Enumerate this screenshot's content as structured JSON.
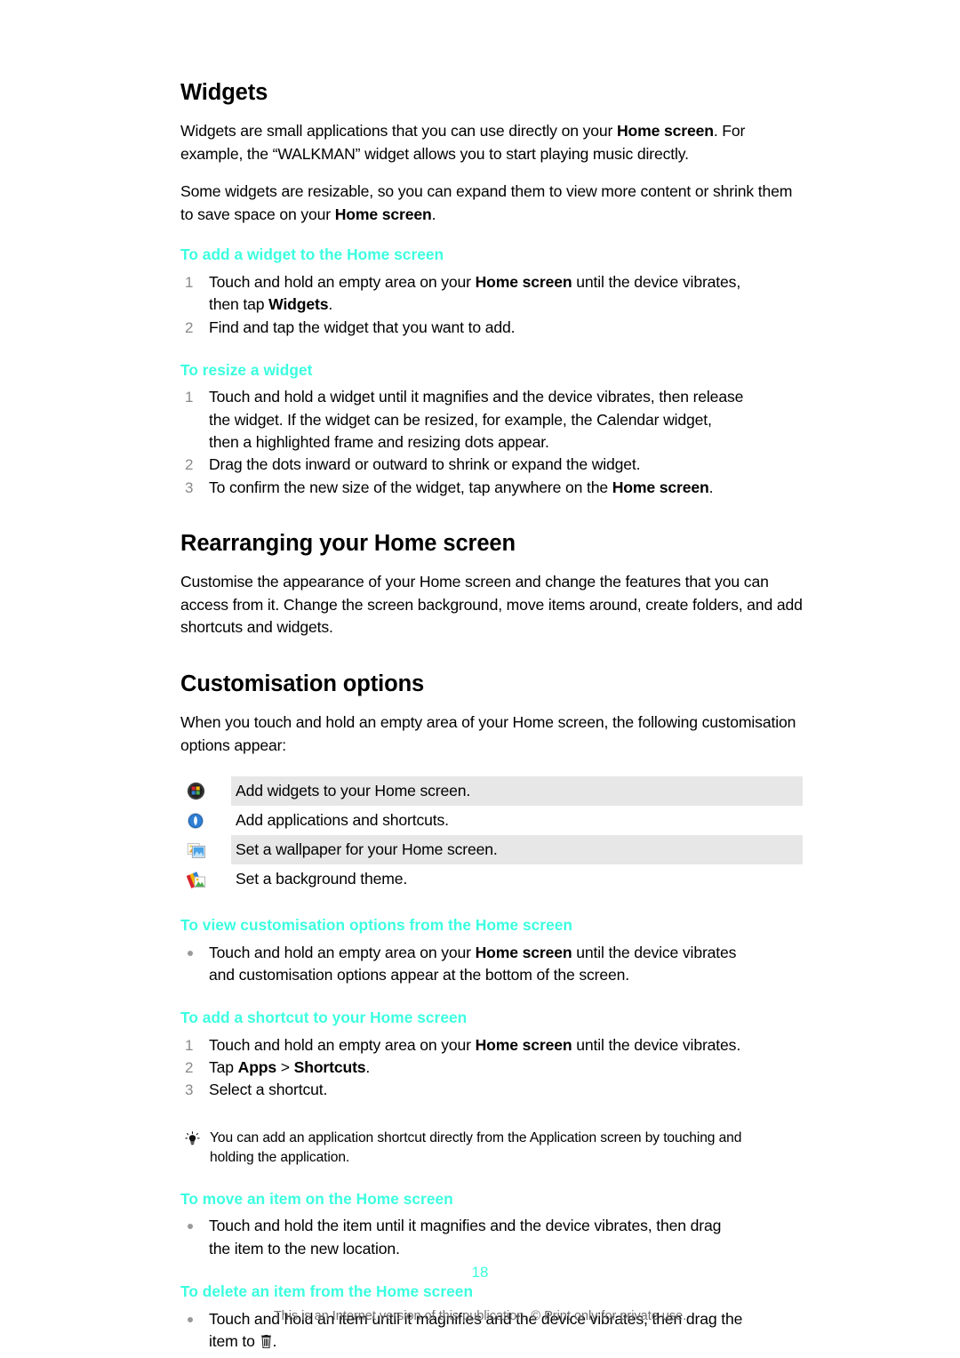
{
  "document": {
    "page_number": "18",
    "footer_note": "This is an Internet version of this publication. © Print only for private use.",
    "accent_color": "#3BFFE0",
    "row_shade_color": "#E7E7E7"
  },
  "sections": [
    {
      "title": "Widgets",
      "paragraphs": [
        "Widgets are small applications that you can use directly on your Home screen. For example, the “WALKMAN” widget allows you to start playing music directly.",
        "Some widgets are resizable, so you can expand them to view more content or shrink them to save space on your Home screen."
      ]
    },
    {
      "title": "Rearranging your Home screen",
      "paragraphs": [
        "Customise the appearance of your Home screen and change the features that you can access from it. Change the screen background, move items around, create folders, and add shortcuts and widgets."
      ]
    },
    {
      "title": "Customisation options",
      "paragraphs": [
        "When you touch and hold an empty area of your Home screen, the following customisation options appear:"
      ]
    }
  ],
  "procedures": {
    "add_widget": {
      "heading": "To add a widget to the Home screen",
      "steps": [
        {
          "marker": "1",
          "text": "Touch and hold an empty area on your Home screen until the device vibrates, then tap Widgets."
        },
        {
          "marker": "2",
          "text": "Find and tap the widget that you want to add."
        }
      ]
    },
    "resize_widget": {
      "heading": "To resize a widget",
      "steps": [
        {
          "marker": "1",
          "text": "Touch and hold a widget until it magnifies and the device vibrates, then release the widget. If the widget can be resized, for example, the Calendar widget, then a highlighted frame and resizing dots appear."
        },
        {
          "marker": "2",
          "text": "Drag the dots inward or outward to shrink or expand the widget."
        },
        {
          "marker": "3",
          "text": "To confirm the new size of the widget, tap anywhere on the Home screen."
        }
      ]
    },
    "view_customisation": {
      "heading": "To view customisation options from the Home screen",
      "steps": [
        {
          "marker": "•",
          "text": "Touch and hold an empty area on your Home screen until the device vibrates and customisation options appear at the bottom of the screen."
        }
      ]
    },
    "add_shortcut": {
      "heading": "To add a shortcut to your Home screen",
      "steps": [
        {
          "marker": "1",
          "text": "Touch and hold an empty area on your Home screen until the device vibrates."
        },
        {
          "marker": "2",
          "text": "Tap Apps > Shortcuts."
        },
        {
          "marker": "3",
          "text": "Select a shortcut."
        }
      ]
    },
    "move_item": {
      "heading": "To move an item on the Home screen",
      "steps": [
        {
          "marker": "•",
          "text": "Touch and hold the item until it magnifies and the device vibrates, then drag the item to the new location."
        }
      ]
    },
    "delete_item": {
      "heading": "To delete an item from the Home screen",
      "steps": [
        {
          "marker": "•",
          "text": "Touch and hold an item until it magnifies and the device vibrates, then drag the item to ."
        }
      ]
    }
  },
  "tip": {
    "icon": "lightbulb-icon",
    "text": "You can add an application shortcut directly from the Application screen by touching and holding the application."
  },
  "options_table": [
    {
      "icon": "widgets-icon",
      "label": "Add widgets to your Home screen.",
      "shaded": true
    },
    {
      "icon": "apps-icon",
      "label": "Add applications and shortcuts.",
      "shaded": false
    },
    {
      "icon": "wallpaper-icon",
      "label": "Set a wallpaper for your Home screen.",
      "shaded": true
    },
    {
      "icon": "theme-icon",
      "label": "Set a background theme.",
      "shaded": false
    }
  ]
}
